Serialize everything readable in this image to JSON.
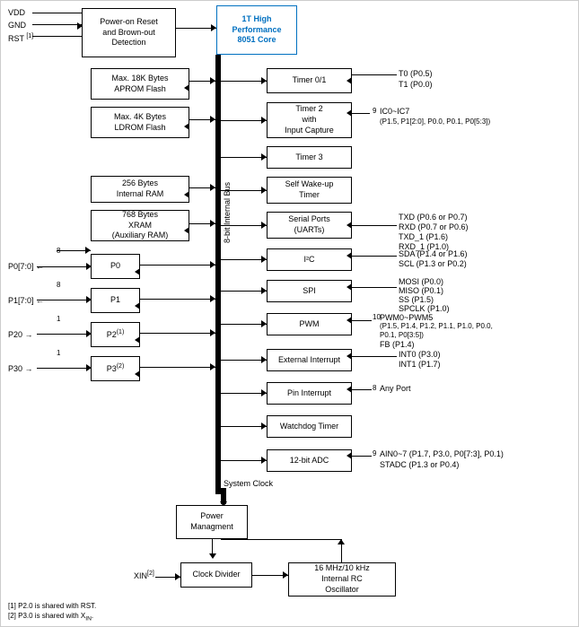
{
  "blocks": {
    "vdd": "VDD",
    "gnd": "GND",
    "rst": "RST",
    "power_on_reset": "Power-on Reset\nand Brown-out\nDetection",
    "core": "1T High\nPerformance\n8051 Core",
    "aprom": "Max. 18K Bytes\nAPROM Flash",
    "ldrom": "Max. 4K Bytes\nLDROM Flash",
    "internal_ram": "256 Bytes\nInternal RAM",
    "xram": "768 Bytes\nXRAM\n(Auxiliary RAM)",
    "timer01": "Timer 0/1",
    "timer2": "Timer 2\nwith\nInput Capture",
    "timer3": "Timer 3",
    "self_wakeup": "Self Wake-up\nTimer",
    "serial_ports": "Serial Ports\n(UARTs)",
    "i2c": "I²C",
    "spi": "SPI",
    "pwm": "PWM",
    "external_interrupt": "External Interrupt",
    "pin_interrupt": "Pin Interrupt",
    "watchdog": "Watchdog Timer",
    "adc": "12-bit ADC",
    "p0": "P0",
    "p1": "P1",
    "p2": "P2",
    "p3": "P3",
    "system_clock": "System Clock",
    "power_management": "Power\nManagment",
    "clock_divider": "Clock Divider",
    "oscillator": "16 MHz/10 kHz\nInternal RC\nOscillator",
    "bus_label": "8-bit Internal Bus",
    "t0": "T0 (P0.5)",
    "t1": "T1 (P0.0)",
    "ic0_ic7": "IC0~IC7",
    "ic0_detail": "(P1.5, P1[2:0], P0.0, P0.1, P0[5:3])",
    "txd": "TXD (P0.6 or P0.7)",
    "rxd": "RXD (P0.7 or P0.6)",
    "txd1": "TXD_1 (P1.6)",
    "rxd1": "RXD_1 (P1.0)",
    "sda": "SDA (P1.4 or P1.6)",
    "scl": "SCL (P1.3 or P0.2)",
    "mosi": "MOSI (P0.0)",
    "miso": "MISO (P0.1)",
    "ss": "SS (P1.5)",
    "spclk": "SPCLK (P1.0)",
    "pwm_count": "10",
    "pwm_signals": "PWM0~PWM5",
    "pwm_detail": "(P1.5, P1.4, P1.2, P1.1, P1.0, P0.0,",
    "pwm_detail2": "P0.1, P0[3:5])",
    "fb": "FB (P1.4)",
    "int0": "INT0 (P3.0)",
    "int1": "INT1 (P1.7)",
    "pin_int_count": "8",
    "pin_int_label": "Any Port",
    "adc_count": "9",
    "ain": "AIN0~7 (P1.7, P3.0, P0[7:3], P0.1)",
    "stadc": "STADC (P1.3 or P0.4)",
    "p0_bus": "8",
    "p1_bus": "8",
    "p2_bus": "1",
    "p3_bus": "1",
    "p0_label": "P0[7:0]",
    "p1_label": "P1[7:0]",
    "p20_label": "P20",
    "p30_label": "P30",
    "xin_label": "XIN",
    "footnote1": "[1] P2.0 is shared with RST.",
    "footnote2": "[2] P3.0 is shared with X",
    "footnote2b": "IN.",
    "sup1": "(1)",
    "sup2": "(2)",
    "sup3": "(1)",
    "sup4": "(2)"
  }
}
